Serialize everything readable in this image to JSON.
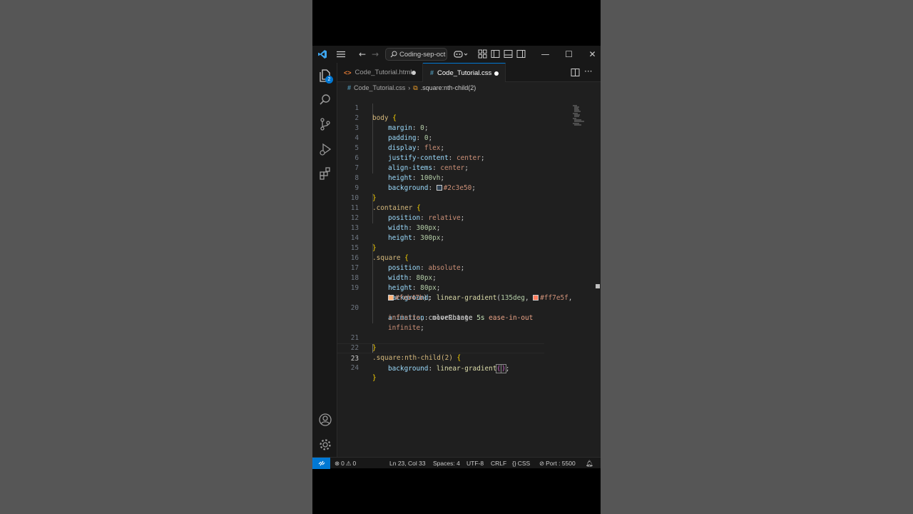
{
  "titlebar": {
    "search_label": "Coding-sep-oct"
  },
  "tabs": [
    {
      "label": "Code_Tutorial.html",
      "icon": "html-file-icon",
      "modified": true,
      "active": false
    },
    {
      "label": "Code_Tutorial.css",
      "icon": "css-file-icon",
      "modified": true,
      "active": true
    }
  ],
  "breadcrumb": {
    "file": "Code_Tutorial.css",
    "symbol": ".square:nth-child(2)"
  },
  "activity_badge": "2",
  "editor": {
    "line_numbers": [
      "1",
      "2",
      "3",
      "4",
      "5",
      "6",
      "7",
      "8",
      "9",
      "10",
      "11",
      "12",
      "13",
      "14",
      "15",
      "16",
      "17",
      "18",
      "19",
      "",
      "20",
      "",
      "",
      "21",
      "22",
      "23",
      "24"
    ],
    "active_line": "23",
    "colors": {
      "swatch_1": "#2c3e50",
      "swatch_2": "#ff7e5f",
      "swatch_3": "#feb47b"
    },
    "code": {
      "l1_sel": "body",
      "l2_prop": "margin",
      "l2_val": "0",
      "l3_prop": "padding",
      "l3_val": "0",
      "l4_prop": "display",
      "l4_val": "flex",
      "l5_prop": "justify-content",
      "l5_val": "center",
      "l6_prop": "align-items",
      "l6_val": "center",
      "l7_prop": "height",
      "l7_val": "100vh",
      "l8_prop": "background",
      "l8_val": "#2c3e50",
      "l10_sel": ".container",
      "l11_prop": "position",
      "l11_val": "relative",
      "l12_prop": "width",
      "l12_val": "300px",
      "l13_prop": "height",
      "l13_val": "300px",
      "l15_sel": ".square",
      "l16_prop": "position",
      "l16_val": "absolute",
      "l17_prop": "width",
      "l17_val": "80px",
      "l18_prop": "height",
      "l18_val": "80px",
      "l19_prop": "background",
      "l19_fn": "linear-gradient",
      "l19_deg": "135deg",
      "l19_c1": "#ff7e5f",
      "l19b_c2": "#feb47b",
      "l20_prop": "animation",
      "l20_name": "moveRotate",
      "l20_dur": "5s",
      "l20_ease": "ease-in-out",
      "l20b_inf": "infinite",
      "l20b_name": "colorChange",
      "l20b_dur": "5s",
      "l20b_ease": "ease-in-out",
      "l20c_inf": "infinite",
      "l22_sel": ".square:nth-child(2)",
      "l23_prop": "background",
      "l23_fn": "linear-gradient"
    }
  },
  "status": {
    "errors": "0",
    "warnings": "0",
    "position": "Ln 23, Col 33",
    "spaces": "Spaces: 4",
    "encoding": "UTF-8",
    "eol": "CRLF",
    "language": "CSS",
    "port": "Port : 5500"
  }
}
